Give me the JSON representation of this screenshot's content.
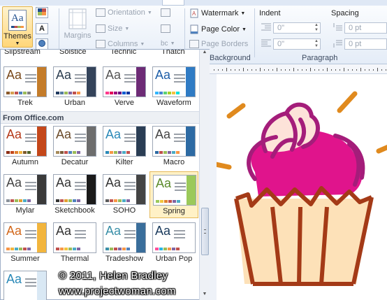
{
  "ribbon": {
    "themes_label": "Themes",
    "margins_label": "Margins",
    "orientation_label": "Orientation",
    "size_label": "Size",
    "columns_label": "Columns",
    "watermark_label": "Watermark",
    "page_color_label": "Page Color",
    "page_borders_label": "Page Borders",
    "background_group": "Background",
    "indent_label": "Indent",
    "spacing_label": "Spacing",
    "paragraph_group": "Paragraph",
    "indent_left": "0\"",
    "indent_right": "0\"",
    "spacing_before": "0 pt",
    "spacing_after": "0 pt"
  },
  "gallery": {
    "top_partial_names": [
      "Slipstream",
      "Solstice",
      "Technic",
      "Thatch"
    ],
    "builtin_row": [
      {
        "name": "Trek",
        "aa_color": "#7a4a1c",
        "stripe": "#c47c2a",
        "swatches": [
          "#8b5a2b",
          "#d5a050",
          "#c0504d",
          "#4f81bd",
          "#9bbb59",
          "#7f7f7f"
        ]
      },
      {
        "name": "Urban",
        "aa_color": "#2c3e50",
        "stripe": "#34435a",
        "swatches": [
          "#1f3a5f",
          "#557aa0",
          "#9bbb59",
          "#8064a2",
          "#c0504d",
          "#f79646"
        ]
      },
      {
        "name": "Verve",
        "aa_color": "#555555",
        "stripe": "#6d2b76",
        "swatches": [
          "#ff388c",
          "#e40059",
          "#9c007f",
          "#68007f",
          "#005bd3",
          "#00349e"
        ]
      },
      {
        "name": "Waveform",
        "aa_color": "#1f5fa8",
        "stripe": "#2f7bc4",
        "swatches": [
          "#31b6fd",
          "#4584d3",
          "#5bd078",
          "#a5d028",
          "#f5c040",
          "#05e0db"
        ]
      }
    ],
    "office_header": "From Office.com",
    "office_themes": [
      {
        "name": "Autumn",
        "aa_color": "#b53a1a",
        "stripe": "#c4471a",
        "swatches": [
          "#8b2d14",
          "#c4471a",
          "#e0812e",
          "#f2b53d",
          "#7e5b2c",
          "#4f6228"
        ]
      },
      {
        "name": "Decatur",
        "aa_color": "#6b4b2a",
        "stripe": "#6d6d6d",
        "swatches": [
          "#a68b5b",
          "#7b5b3a",
          "#c0504d",
          "#4f81bd",
          "#9bbb59",
          "#8064a2"
        ]
      },
      {
        "name": "Kilter",
        "aa_color": "#2a89b8",
        "stripe": "#2a3d54",
        "swatches": [
          "#2a89b8",
          "#f79646",
          "#9bbb59",
          "#8064a2",
          "#4bacc6",
          "#c0504d"
        ]
      },
      {
        "name": "Macro",
        "aa_color": "#444444",
        "stripe": "#2d6aa3",
        "swatches": [
          "#2d6aa3",
          "#c0504d",
          "#9bbb59",
          "#8064a2",
          "#4bacc6",
          "#f79646"
        ]
      },
      {
        "name": "Mylar",
        "aa_color": "#444444",
        "stripe": "#3a3a3a",
        "swatches": [
          "#8a9099",
          "#c0504d",
          "#9bbb59",
          "#e0a030",
          "#4bacc6",
          "#8064a2"
        ]
      },
      {
        "name": "Sketchbook",
        "aa_color": "#333333",
        "stripe": "#1a1a1a",
        "swatches": [
          "#333333",
          "#c0504d",
          "#e0a030",
          "#9bbb59",
          "#4f81bd",
          "#8064a2"
        ]
      },
      {
        "name": "SOHO",
        "aa_color": "#333333",
        "stripe": "#444444",
        "swatches": [
          "#5b5b5b",
          "#c0504d",
          "#f79646",
          "#9bbb59",
          "#4bacc6",
          "#8064a2"
        ]
      },
      {
        "name": "Spring",
        "aa_color": "#5a8a2a",
        "stripe": "#9bc95a",
        "swatches": [
          "#9bc95a",
          "#f2c53d",
          "#e0812e",
          "#c0504d",
          "#8064a2",
          "#4bacc6"
        ]
      },
      {
        "name": "Summer",
        "aa_color": "#d2691e",
        "stripe": "#f2b53d",
        "swatches": [
          "#f79646",
          "#f2b53d",
          "#4bacc6",
          "#9bbb59",
          "#c0504d",
          "#8064a2"
        ]
      },
      {
        "name": "Thermal",
        "aa_color": "#333333",
        "stripe": "#ffffff",
        "swatches": [
          "#c0504d",
          "#f79646",
          "#f2c53d",
          "#9bbb59",
          "#4bacc6",
          "#8064a2"
        ]
      },
      {
        "name": "Tradeshow",
        "aa_color": "#3a8fa8",
        "stripe": "#3a6e9b",
        "swatches": [
          "#3a8fa8",
          "#9bbb59",
          "#c0504d",
          "#8064a2",
          "#f79646",
          "#4f81bd"
        ]
      },
      {
        "name": "Urban Pop",
        "aa_color": "#1a3a5c",
        "stripe": "#ffffff",
        "swatches": [
          "#ff4f9a",
          "#27b6e3",
          "#9bbb59",
          "#f79646",
          "#8064a2",
          "#c0504d"
        ]
      }
    ],
    "last_partial": {
      "aa_color": "#2a89b8",
      "stripe": "#d9e8f4",
      "swatches": []
    }
  },
  "watermark_line1": "© 2011, Helen Bradley",
  "watermark_line2": "www.projectwoman.com",
  "colors": {
    "selection": "#fff1c6",
    "cupcake_magenta": "#e0148c",
    "cupcake_purple": "#a41d7a",
    "cupcake_brown": "#a43a17",
    "cupcake_orange": "#e08a1e",
    "cupcake_cream": "#fde1b8"
  }
}
